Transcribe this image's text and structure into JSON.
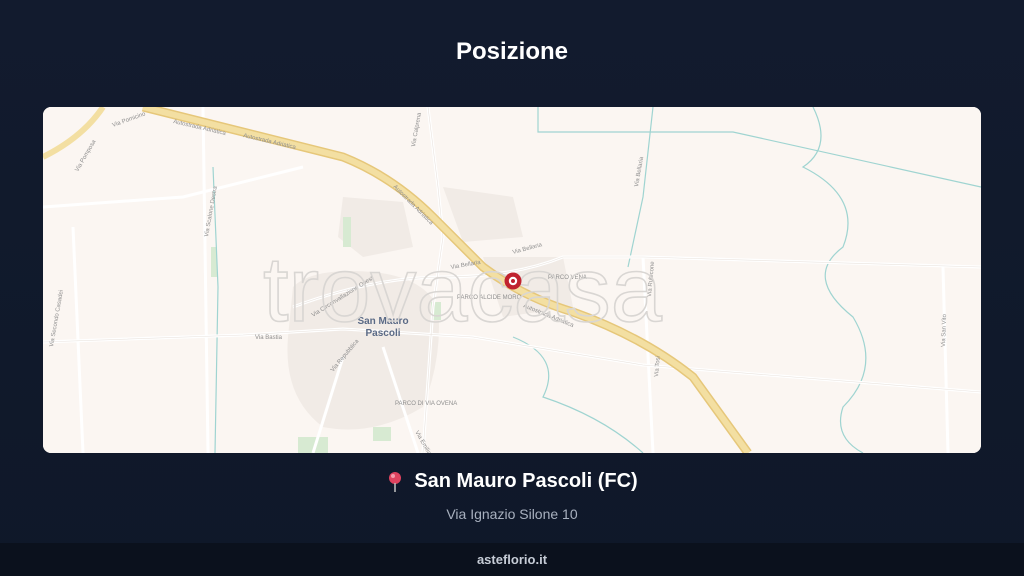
{
  "header": {
    "title": "Posizione"
  },
  "map": {
    "watermark": "trovacasa",
    "town_label_line1": "San Mauro",
    "town_label_line2": "Pascoli",
    "road_labels": {
      "autostrada_1": "Autostrada Adriatica",
      "autostrada_2": "Autostrada Adriatica",
      "autostrada_3": "Autostrada Adriatica",
      "autostrada_4": "Autostrada Adriatica",
      "via_pomicino": "Via Pomicino",
      "via_pomposa": "Via Pomposa",
      "via_calprena": "Via Calprena",
      "via_bellaria_1": "Via Bellaria",
      "via_bellaria_2": "Via Bellaria",
      "via_bellaria_3": "Via Bellaria",
      "via_circonvallazione": "Via Circonvallazione Ovest",
      "via_bastia": "Via Bastia",
      "via_secondo_casadei": "Via Secondo Casadei",
      "via_scalone": "Via Scalone Destra",
      "via_rubicone": "Via Rubicone",
      "via_tosi": "Via Tosi",
      "via_san_vito": "Via San Vito",
      "via_repubblica": "Via Repubblica",
      "via_emilia": "Via Emilia",
      "parco_vena": "PARCO VENA",
      "parco_alcide": "PARCO ALCIDE MORO",
      "parco_via_ovena": "PARCO DI VIA OVENA"
    },
    "colors": {
      "land": "#fbf6f2",
      "motorway": "#f3dfa2",
      "water": "#9fd4d1",
      "marker": "#c0232f",
      "park": "#d7ead2"
    }
  },
  "location": {
    "city": "San Mauro Pascoli (FC)",
    "address": "Via Ignazio Silone 10",
    "icon": "map-pin-icon"
  },
  "footer": {
    "brand": "asteflorio.it"
  }
}
